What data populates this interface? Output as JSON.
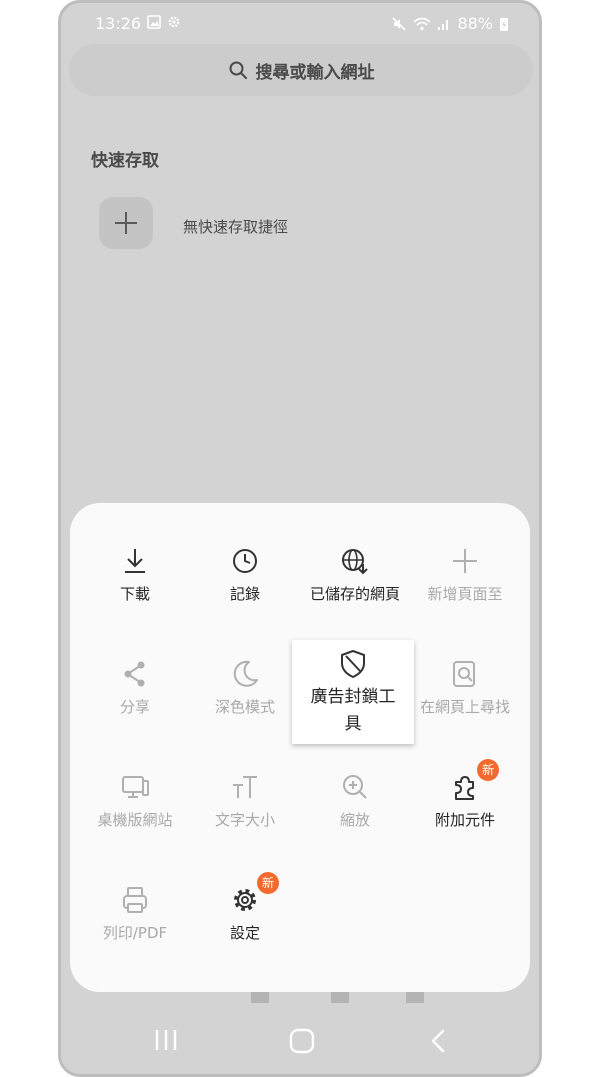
{
  "status_bar": {
    "time": "13:26",
    "battery": "88%"
  },
  "search": {
    "placeholder": "搜尋或輸入網址"
  },
  "quick_access": {
    "title": "快速存取",
    "empty_text": "無快速存取捷徑"
  },
  "menu": {
    "items": [
      {
        "label": "下載",
        "icon": "download-icon",
        "enabled": true
      },
      {
        "label": "記錄",
        "icon": "clock-icon",
        "enabled": true
      },
      {
        "label": "已儲存的網頁",
        "icon": "saved-pages-globe-icon",
        "enabled": true
      },
      {
        "label": "新增頁面至",
        "icon": "plus-icon",
        "enabled": false
      },
      {
        "label": "分享",
        "icon": "share-icon",
        "enabled": false
      },
      {
        "label": "深色模式",
        "icon": "moon-icon",
        "enabled": false
      },
      {
        "label": "廣告封鎖工具",
        "icon": "shield-icon",
        "enabled": true,
        "highlighted": true
      },
      {
        "label": "在網頁上尋找",
        "icon": "find-in-page-icon",
        "enabled": false
      },
      {
        "label": "桌機版網站",
        "icon": "desktop-icon",
        "enabled": false
      },
      {
        "label": "文字大小",
        "icon": "text-size-icon",
        "enabled": false
      },
      {
        "label": "縮放",
        "icon": "zoom-in-icon",
        "enabled": false
      },
      {
        "label": "附加元件",
        "icon": "puzzle-icon",
        "enabled": true,
        "badge": "新"
      },
      {
        "label": "列印/PDF",
        "icon": "printer-icon",
        "enabled": false
      },
      {
        "label": "設定",
        "icon": "gear-icon",
        "enabled": true,
        "badge": "新"
      }
    ]
  },
  "colors": {
    "badge": "#f26a2e",
    "sheet_bg": "#fafafa",
    "dim_bg": "#d3d3d3"
  }
}
